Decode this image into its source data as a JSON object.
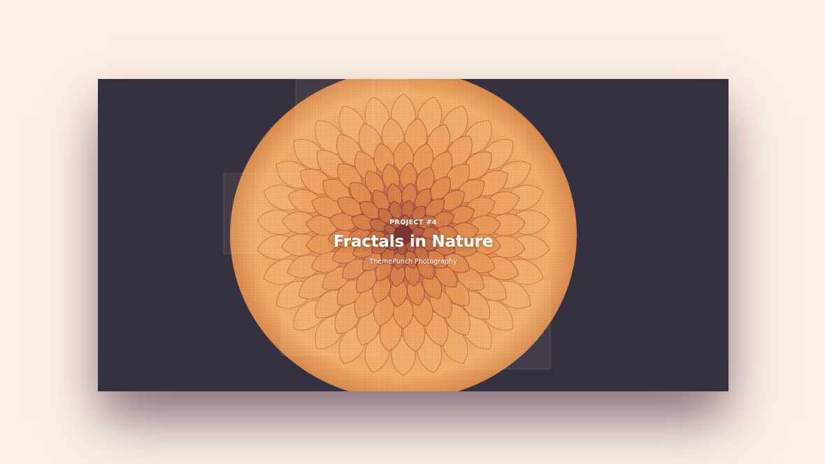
{
  "page": {
    "background_color": "#fdefe4"
  },
  "slide": {
    "background_color": "#35303f",
    "image": {
      "subject": "dahlia-flower",
      "petal_color": "#f0a35c",
      "petal_shadow_color": "#c36a3a",
      "center_color": "#a84f3c"
    },
    "caption": {
      "kicker": "PROJECT #4",
      "title": "Fractals in Nature",
      "subtitle": "ThemePunch Photography"
    }
  }
}
